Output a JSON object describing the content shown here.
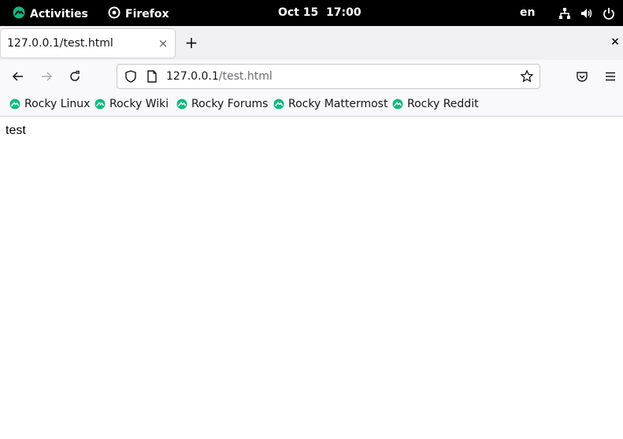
{
  "topbar": {
    "activities": "Activities",
    "app_name": "Firefox",
    "clock": "Oct 15  17:00",
    "lang": "en"
  },
  "tab": {
    "title": "127.0.0.1/test.html",
    "close": "×",
    "new_tab": "+"
  },
  "window": {
    "close": "×"
  },
  "urlbar": {
    "host": "127.0.0.1",
    "path": "/test.html"
  },
  "bookmarks": [
    {
      "label": "Rocky Linux",
      "icon": "rocky-logo-icon"
    },
    {
      "label": "Rocky Wiki",
      "icon": "rocky-logo-icon"
    },
    {
      "label": "Rocky Forums",
      "icon": "rocky-logo-icon"
    },
    {
      "label": "Rocky Mattermost",
      "icon": "rocky-logo-icon"
    },
    {
      "label": "Rocky Reddit",
      "icon": "rocky-logo-icon"
    }
  ],
  "page": {
    "body_text": "test"
  },
  "colors": {
    "rocky_green": "#10b981",
    "topbar_bg": "#000000"
  }
}
